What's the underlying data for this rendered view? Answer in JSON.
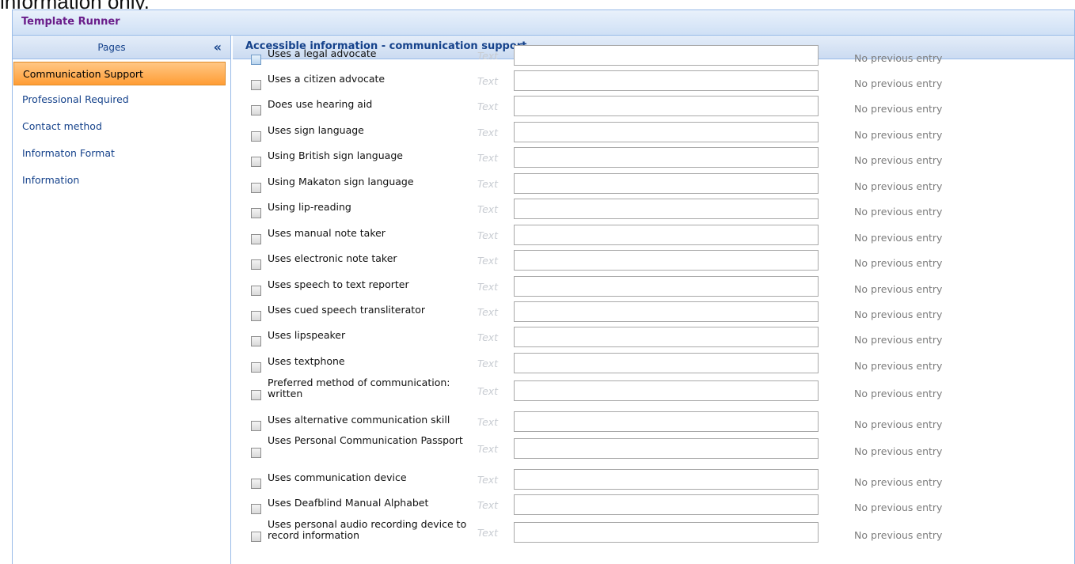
{
  "caption": "information only.",
  "window": {
    "title": "Template Runner"
  },
  "sidebar": {
    "header": "Pages",
    "collapse_glyph": "«",
    "items": [
      {
        "label": "Communication Support",
        "active": true
      },
      {
        "label": "Professional Required"
      },
      {
        "label": "Contact method"
      },
      {
        "label": "Informaton Format"
      },
      {
        "label": "Information"
      }
    ]
  },
  "main": {
    "title": "Accessible information - communication support",
    "text_tag": "Text",
    "prev_text": "No previous entry",
    "rows": [
      {
        "label": "Uses a legal advocate"
      },
      {
        "label": "Uses a citizen advocate"
      },
      {
        "label": "Does use hearing aid"
      },
      {
        "label": "Uses sign language"
      },
      {
        "label": "Using British sign language"
      },
      {
        "label": "Using Makaton sign language"
      },
      {
        "label": "Using lip-reading"
      },
      {
        "label": "Uses manual note taker"
      },
      {
        "label": "Uses electronic note taker"
      },
      {
        "label": "Uses speech to text reporter"
      },
      {
        "label": "Uses cued speech transliterator"
      },
      {
        "label": "Uses lipspeaker"
      },
      {
        "label": "Uses textphone"
      },
      {
        "label": "Preferred method of communication: written"
      },
      {
        "label": "Uses alternative communication skill"
      },
      {
        "label": "Uses Personal Communication Passport"
      },
      {
        "label": "Uses communication device"
      },
      {
        "label": "Uses Deafblind Manual Alphabet"
      },
      {
        "label": "Uses personal audio recording device to record information"
      }
    ]
  }
}
